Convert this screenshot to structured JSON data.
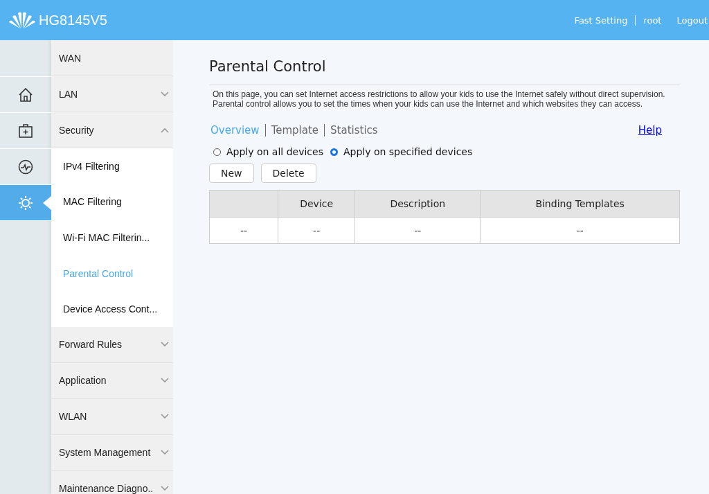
{
  "header": {
    "title": "HG8145V5",
    "links": [
      "Fast Setting",
      "root",
      "Logout"
    ]
  },
  "rail": [
    {
      "selected": false
    },
    {
      "selected": false
    },
    {
      "selected": false
    },
    {
      "selected": true
    }
  ],
  "menu": [
    {
      "kind": "plain",
      "label": "WAN"
    },
    {
      "kind": "folder",
      "label": "LAN",
      "expanded": false
    },
    {
      "kind": "folder",
      "label": "Security",
      "expanded": true,
      "children": [
        {
          "label": "IPv4 Filtering",
          "selected": false
        },
        {
          "label": "MAC Filtering",
          "selected": false
        },
        {
          "label": "Wi-Fi MAC Filterin...",
          "selected": false
        },
        {
          "label": "Parental Control",
          "selected": true
        },
        {
          "label": "Device Access Cont...",
          "selected": false
        }
      ]
    },
    {
      "kind": "folder",
      "label": "Forward Rules",
      "expanded": false
    },
    {
      "kind": "folder",
      "label": "Application",
      "expanded": false
    },
    {
      "kind": "folder",
      "label": "WLAN",
      "expanded": false
    },
    {
      "kind": "folder",
      "label": "System Management",
      "expanded": false
    },
    {
      "kind": "folder",
      "label": "Maintenance Diagno..",
      "expanded": false
    }
  ],
  "page": {
    "title": "Parental Control",
    "description": [
      "On this page, you can set Internet access restrictions to allow your kids to use the Internet safely without direct supervision.",
      "Parental control allows you to set the times when your kids can use the Internet and which websites they can access."
    ],
    "tabs": [
      {
        "label": "Overview",
        "selected": true
      },
      {
        "label": "Template",
        "selected": false
      },
      {
        "label": "Statistics",
        "selected": false
      }
    ],
    "help": "Help",
    "options": [
      {
        "label": "Apply on all devices",
        "selected": false
      },
      {
        "label": "Apply on specified devices",
        "selected": true
      }
    ],
    "buttons": [
      "New",
      "Delete"
    ],
    "table": {
      "columns": [
        "",
        "Device",
        "Description",
        "Binding Templates"
      ],
      "rows": [
        [
          "--",
          "--",
          "--",
          "--"
        ]
      ]
    }
  }
}
